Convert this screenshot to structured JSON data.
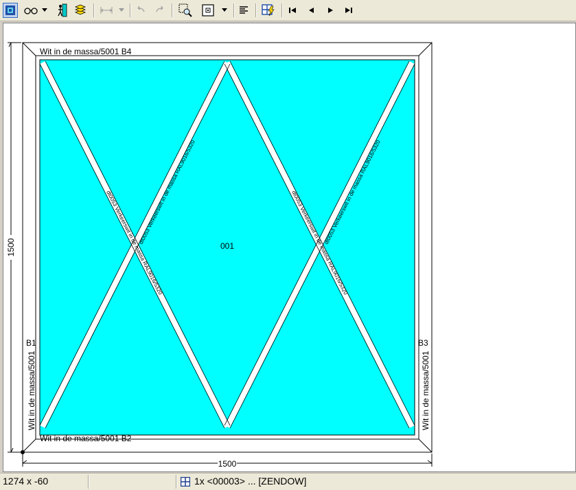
{
  "toolbar": {
    "buttons": [
      {
        "name": "frame-tool-icon",
        "state": "active"
      },
      {
        "name": "glasses-icon"
      },
      {
        "name": "glasses-dropdown-icon"
      },
      {
        "name": "door-icon"
      },
      {
        "name": "layers-icon"
      },
      {
        "name": "dimension-icon",
        "state": "disabled"
      },
      {
        "name": "dimension-dropdown-icon",
        "state": "disabled"
      },
      {
        "name": "undo-icon",
        "state": "disabled"
      },
      {
        "name": "redo-icon",
        "state": "disabled"
      },
      {
        "name": "zoom-select-icon"
      },
      {
        "name": "view-mode-icon"
      },
      {
        "name": "view-mode-dropdown-icon"
      },
      {
        "name": "align-left-icon"
      },
      {
        "name": "grid-lightning-icon"
      },
      {
        "name": "first-icon"
      },
      {
        "name": "previous-icon"
      },
      {
        "name": "next-icon"
      },
      {
        "name": "last-icon"
      }
    ]
  },
  "drawing": {
    "top_label": "Wit in de massa/5001 B4",
    "bottom_label": "Wit in de massa/5001 B2",
    "left_label": "Wit in de massa/5001",
    "left_code": "B1",
    "right_label": "Wit in de massa/5001",
    "right_code": "B3",
    "panel_label": "001",
    "width_dimension": "1500",
    "height_dimension": "1500",
    "bar_label_a": "dt0053 Verkeerswit in de massa RAL9016/5320",
    "bar_label_b": "dt0053 Verkeerswit in de massa RAL9016/5320",
    "glass_color": "#00ffff",
    "bar_color": "#ffffff"
  },
  "status": {
    "coordinates": "1274 x -60",
    "document": "1x <00003> ... [ZENDOW]"
  }
}
